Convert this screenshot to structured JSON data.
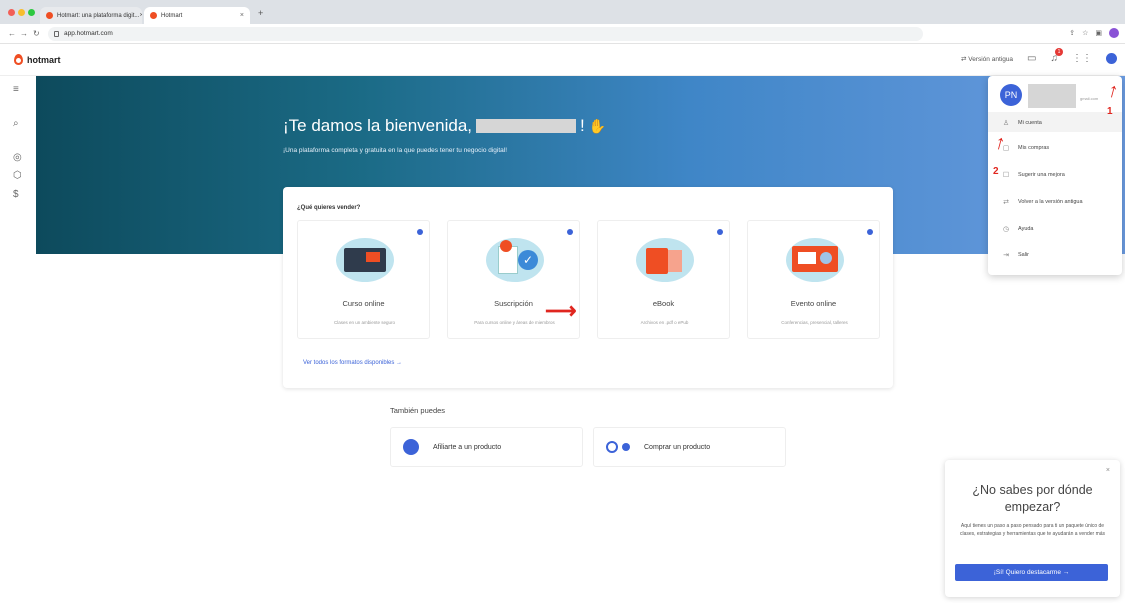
{
  "browser": {
    "tabs": [
      {
        "title": "Hotmart: una plataforma digit..."
      },
      {
        "title": "Hotmart"
      }
    ],
    "new_tab": "+",
    "url": "app.hotmart.com"
  },
  "appbar": {
    "logo": "hotmart",
    "old_version": "Versión antigua",
    "notifications_badge": "1"
  },
  "hero": {
    "title_prefix": "¡Te damos la bienvenida,",
    "title_suffix": "!",
    "subtitle": "¡Una plataforma completa y gratuita en la que puedes tener tu negocio digital!"
  },
  "sell": {
    "question": "¿Qué quieres vender?",
    "cards": [
      {
        "title": "Curso online",
        "desc": "Clases en un ambiente seguro"
      },
      {
        "title": "Suscripción",
        "desc": "Para cursos online y áreas de miembros"
      },
      {
        "title": "eBook",
        "desc": "Archivos en .pdf o ePub"
      },
      {
        "title": "Evento online",
        "desc": "Conferencias, presencial, talleres"
      }
    ],
    "all_formats_link": "Ver todos los formatos disponibles →"
  },
  "also": {
    "heading": "También puedes",
    "items": [
      {
        "label": "Afiliarte a un producto"
      },
      {
        "label": "Comprar un producto"
      }
    ]
  },
  "dropdown": {
    "avatar_initials": "PN",
    "email_hint": "gmail.com",
    "items": [
      {
        "label": "Mi cuenta",
        "icon": "user-icon"
      },
      {
        "label": "Mis compras",
        "icon": "cart-icon"
      },
      {
        "label": "Sugerir una mejora",
        "icon": "chat-icon"
      },
      {
        "label": "Volver a la versión antigua",
        "icon": "switch-icon"
      },
      {
        "label": "Ayuda",
        "icon": "help-icon"
      },
      {
        "label": "Salir",
        "icon": "logout-icon"
      }
    ]
  },
  "annotations": {
    "step1": "1",
    "step2": "2"
  },
  "help_widget": {
    "title": "¿No sabes por dónde empezar?",
    "text": "Aquí tienes un paso a paso pensado para ti un paquete único de clases, estrategias y herramientas que te ayudarán a vender más",
    "button": "¡Sí! Quiero destacarme →",
    "close": "×"
  }
}
